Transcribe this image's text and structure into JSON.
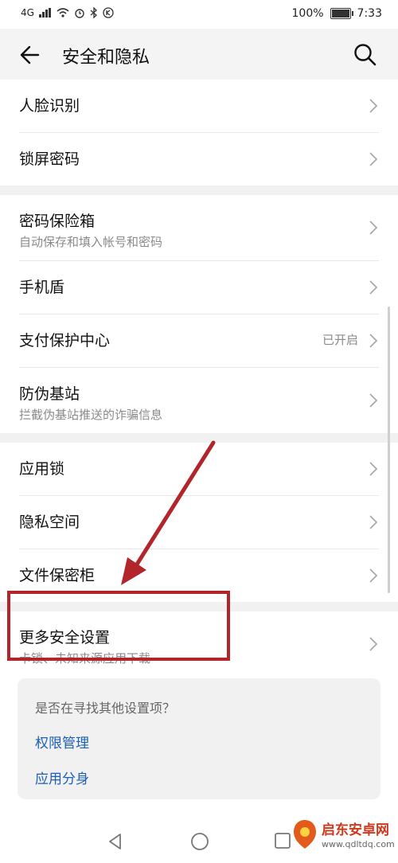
{
  "status": {
    "network": "4G",
    "battery": "100%",
    "time": "7:33",
    "battery_level": 1.0
  },
  "header": {
    "title": "安全和隐私"
  },
  "groups": [
    {
      "items": [
        {
          "title": "人脸识别"
        },
        {
          "title": "锁屏密码"
        }
      ]
    },
    {
      "items": [
        {
          "title": "密码保险箱",
          "subtitle": "自动保存和填入帐号和密码"
        },
        {
          "title": "手机盾"
        },
        {
          "title": "支付保护中心",
          "value": "已开启"
        },
        {
          "title": "防伪基站",
          "subtitle": "拦截伪基站推送的诈骗信息"
        }
      ]
    },
    {
      "items": [
        {
          "title": "应用锁"
        },
        {
          "title": "隐私空间"
        },
        {
          "title": "文件保密柜"
        }
      ]
    },
    {
      "items": [
        {
          "title": "更多安全设置",
          "subtitle": "卡锁、未知来源应用下载"
        }
      ]
    }
  ],
  "suggestion": {
    "question": "是否在寻找其他设置项？",
    "link1": "权限管理",
    "link2": "应用分身"
  },
  "watermark": {
    "name": "启东安卓网",
    "url": "www.qdltdq.com"
  },
  "colors": {
    "link": "#1c5fb5",
    "annotation": "#b2252a"
  }
}
